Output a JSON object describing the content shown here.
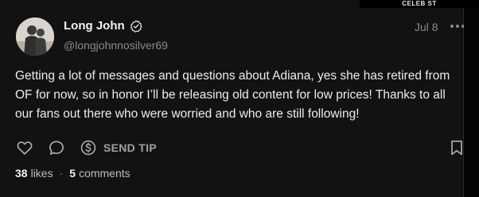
{
  "watermark": "CELEB ST",
  "post": {
    "author_name": "Long John",
    "handle": "@longjohnnosilver69",
    "date": "Jul 8",
    "text": "Getting a lot of messages and questions about Adiana, yes she has retired from OF for now, so in honor I’ll be releasing old content for low prices! Thanks to all our fans out there who were worried and who are still following!",
    "verified": true
  },
  "actions": {
    "like_icon": "heart-icon",
    "comment_icon": "speech-bubble-icon",
    "tip_icon": "dollar-circle-icon",
    "tip_label": "SEND TIP",
    "bookmark_icon": "bookmark-icon"
  },
  "stats": {
    "likes_count": "38",
    "likes_label": "likes",
    "separator": "·",
    "comments_count": "5",
    "comments_label": "comments"
  },
  "colors": {
    "background": "#121212",
    "text": "#ececec",
    "muted": "#8a8a8a"
  }
}
